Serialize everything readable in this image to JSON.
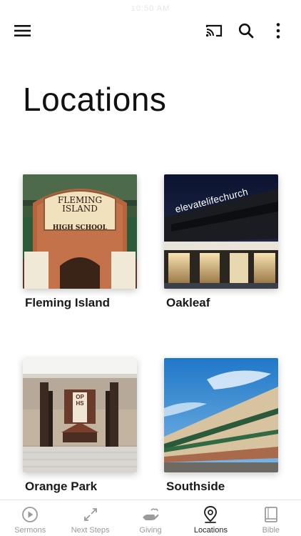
{
  "status": {
    "time": "10:50 AM"
  },
  "header": {
    "title": "Locations"
  },
  "locations": [
    {
      "name": "Fleming Island",
      "sign_line1": "FLEMING",
      "sign_line2": "ISLAND",
      "sign_line3": "HIGH SCHOOL"
    },
    {
      "name": "Oakleaf",
      "sign_text": "elevatelifechurch"
    },
    {
      "name": "Orange Park",
      "banner_letters": "OPHS"
    },
    {
      "name": "Southside"
    }
  ],
  "nav": {
    "items": [
      {
        "label": "Sermons",
        "icon": "play-circle-icon"
      },
      {
        "label": "Next Steps",
        "icon": "arrows-icon"
      },
      {
        "label": "Giving",
        "icon": "giving-hand-icon"
      },
      {
        "label": "Locations",
        "icon": "location-pin-icon"
      },
      {
        "label": "Bible",
        "icon": "book-icon"
      }
    ],
    "active_index": 3
  },
  "colors": {
    "active": "#222222",
    "inactive": "#9a9a9a"
  }
}
